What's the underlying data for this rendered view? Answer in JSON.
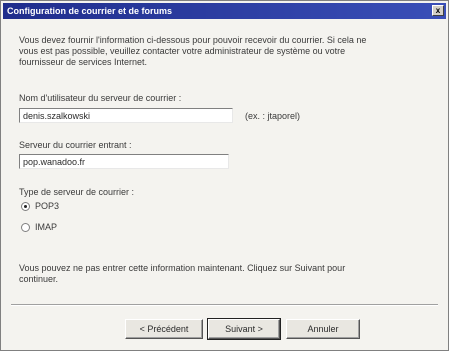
{
  "window": {
    "title": "Configuration de courrier et de forums",
    "close_label": "x"
  },
  "description": "Vous devez fournir l'information ci-dessous pour pouvoir recevoir du courrier. Si cela ne vous est pas possible, veuillez contacter votre administrateur de système ou votre fournisseur de services Internet.",
  "email_field": {
    "label": "Nom d'utilisateur du serveur de courrier :",
    "value": "denis.szalkowski",
    "hint": "(ex. : jtaporel)"
  },
  "incoming_server": {
    "label": "Serveur du courrier entrant :",
    "value": "pop.wanadoo.fr"
  },
  "server_type": {
    "label": "Type de serveur de courrier :",
    "options": [
      {
        "label": "POP3",
        "selected": true
      },
      {
        "label": "IMAP",
        "selected": false
      }
    ]
  },
  "footer_note": "Vous pouvez ne pas entrer cette information maintenant. Cliquez sur Suivant pour continuer.",
  "buttons": {
    "previous": "< Précédent",
    "next": "Suivant >",
    "cancel": "Annuler"
  },
  "colors": {
    "titlebar": "#1f2d8c",
    "background": "#f4f3ef"
  }
}
